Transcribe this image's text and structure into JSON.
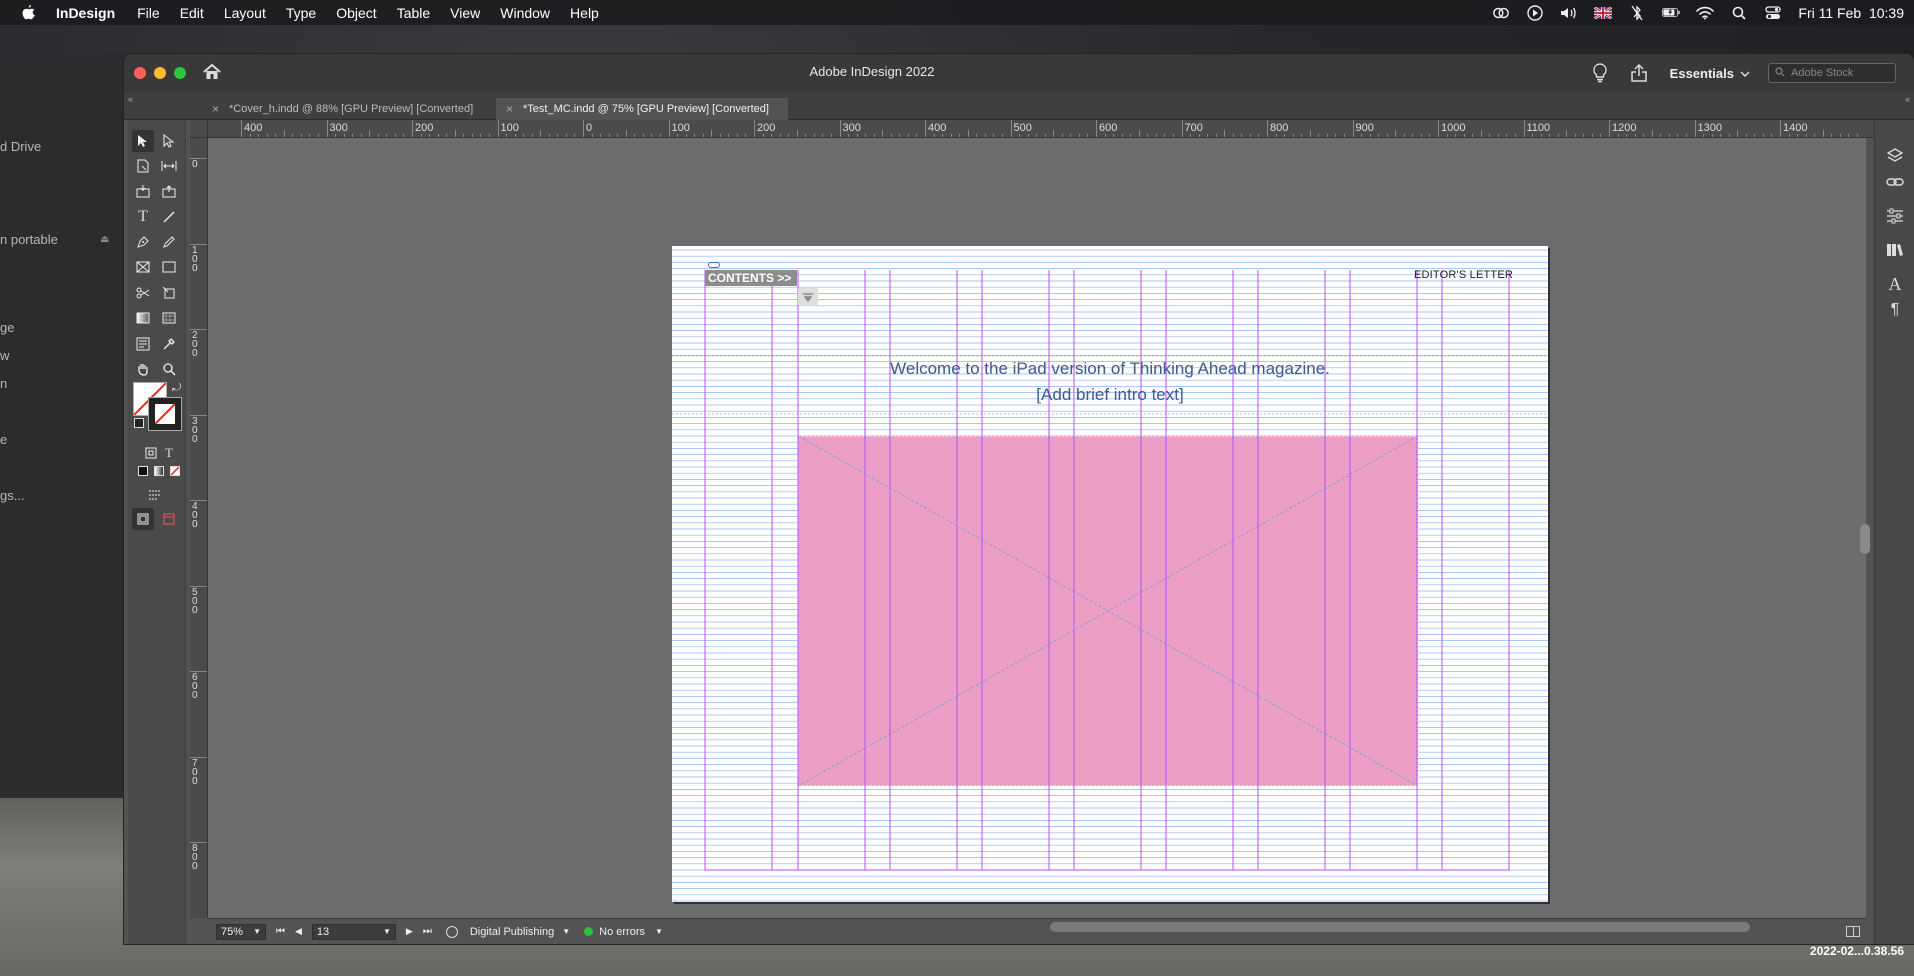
{
  "menubar": {
    "app_name": "InDesign",
    "menus": [
      "File",
      "Edit",
      "Layout",
      "Type",
      "Object",
      "Table",
      "View",
      "Window",
      "Help"
    ],
    "clock": "Fri 11 Feb  10:39"
  },
  "finder_sidebar": {
    "items": [
      "d Drive",
      "n portable",
      "ge",
      "w",
      "n",
      "e",
      "gs..."
    ]
  },
  "window": {
    "title": "Adobe InDesign 2022",
    "workspace": "Essentials",
    "stock_placeholder": "Adobe Stock"
  },
  "tabs": [
    {
      "label": "*Cover_h.indd @ 88% [GPU Preview] [Converted]",
      "active": false
    },
    {
      "label": "*Test_MC.indd @ 75% [GPU Preview] [Converted]",
      "active": true
    }
  ],
  "ruler_h": [
    "400",
    "300",
    "200",
    "100",
    "0",
    "100",
    "200",
    "300",
    "400",
    "500",
    "600",
    "700",
    "800",
    "900",
    "1000",
    "1100",
    "1200",
    "1300",
    "1400"
  ],
  "ruler_v": [
    "0",
    "100",
    "200",
    "300",
    "400",
    "500",
    "600",
    "700",
    "800",
    "0"
  ],
  "document": {
    "contents_label": "CONTENTS >>",
    "editors_letter": "EDITOR'S LETTER",
    "intro_line1": "Welcome to the iPad version of Thinking Ahead magazine.",
    "intro_line2": "[Add brief intro text]",
    "image_fill": "#ec9ec4",
    "column_guide_color": "#b84dff",
    "baseline_color": "#8fb3ef"
  },
  "statusbar": {
    "zoom": "75%",
    "page": "13",
    "intent": "Digital Publishing",
    "preflight": "No errors"
  },
  "desktop_timestamp": "2022-02...0.38.56"
}
